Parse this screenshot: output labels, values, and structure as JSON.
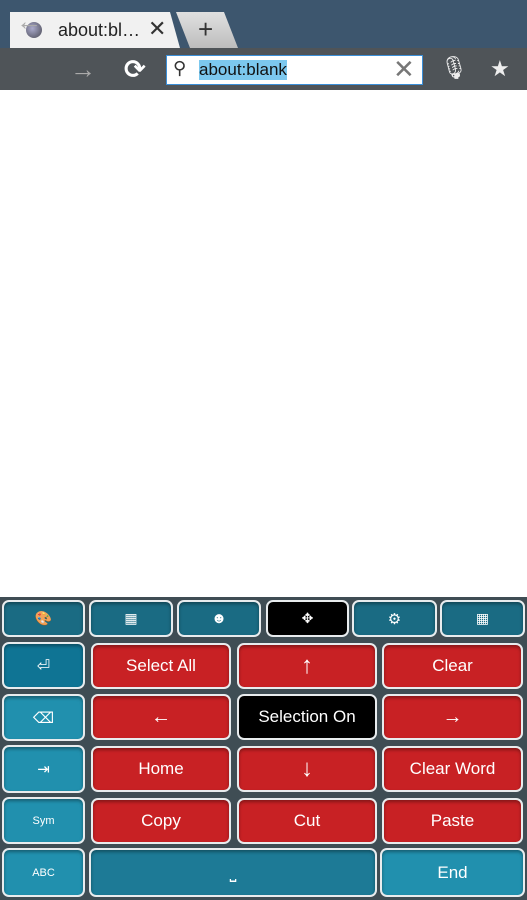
{
  "browser": {
    "tab_title": "about:bl…",
    "tab_close": "✕",
    "new_tab": "+",
    "url": "about:blank",
    "icons": {
      "globe": "globe-icon",
      "back": "arrow-left-icon",
      "forward": "arrow-right-icon",
      "reload": "refresh-icon",
      "search": "search-icon",
      "clear": "close-icon",
      "mic": "microphone-icon",
      "bookmark": "bookmark-star-icon"
    },
    "glyphs": {
      "back": "←",
      "forward": "→",
      "reload": "⟳",
      "search": "⚲",
      "clear": "✕",
      "mic": "🎙",
      "bookmark": "★"
    }
  },
  "keyboard": {
    "top_row": [
      {
        "icon": "palette-icon",
        "glyph": "🎨"
      },
      {
        "icon": "numpad-icon",
        "glyph": "▦"
      },
      {
        "icon": "smiley-icon",
        "glyph": "☻"
      },
      {
        "icon": "move-cursor-icon",
        "glyph": "✥"
      },
      {
        "icon": "settings-icon",
        "glyph": "⚙"
      },
      {
        "icon": "keyboard-hide-icon",
        "glyph": "▦"
      }
    ],
    "side": {
      "enter": "⏎",
      "backspace": "⌫",
      "tab": "⇥",
      "sym": "Sym",
      "abc": "ABC"
    },
    "keys": {
      "select_all": "Select All",
      "up": "↑",
      "clear": "Clear",
      "left": "←",
      "selection_on": "Selection On",
      "right": "→",
      "home": "Home",
      "down": "↓",
      "clear_word": "Clear Word",
      "copy": "Copy",
      "cut": "Cut",
      "paste": "Paste",
      "space": "⎵",
      "end": "End"
    },
    "colors": {
      "teal": "#1a6b83",
      "red": "#c82124",
      "active": "#000000"
    }
  }
}
